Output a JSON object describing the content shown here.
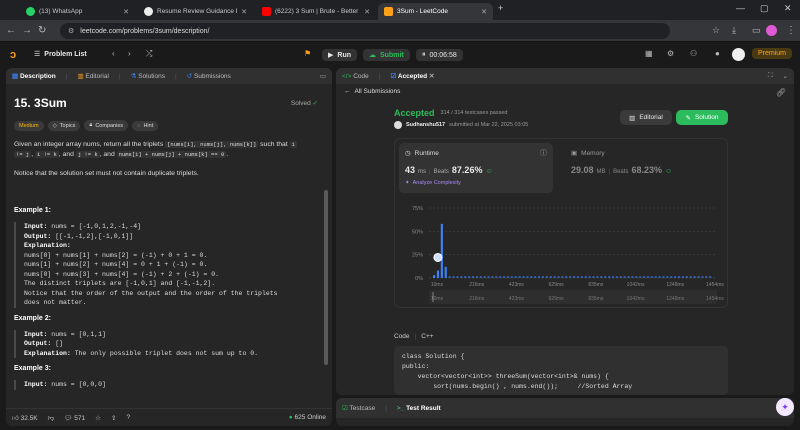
{
  "browser": {
    "tabs": [
      {
        "label": "(13) WhatsApp",
        "color": "#25d366"
      },
      {
        "label": "Resume Review Guidance Fit",
        "color": "#ececec"
      },
      {
        "label": "(6222) 3 Sum | Brute - Better - (",
        "color": "#ff0000"
      },
      {
        "label": "3Sum - LeetCode",
        "color": "#ffa116"
      }
    ],
    "url": "leetcode.com/problems/3sum/description/"
  },
  "header": {
    "problem_list": "Problem List",
    "run": "Run",
    "submit": "Submit",
    "timer": "00:06:58",
    "premium": "Premium"
  },
  "left": {
    "tabs": [
      "Description",
      "Editorial",
      "Solutions",
      "Submissions"
    ],
    "title": "15. 3Sum",
    "solved": "Solved",
    "tags": [
      "Medium",
      "Topics",
      "Companies",
      "Hint"
    ],
    "p1a": "Given an integer array nums, return all the triplets ",
    "p1code1": "[nums[i], nums[j], nums[k]]",
    "p1b": " such that ",
    "p1code2": "i",
    "p1c": "!= j",
    "p1d": ", ",
    "p1code3": "i != k",
    "p1e": ", and ",
    "p1code4": "j != k",
    "p1f": ", and ",
    "p1code5": "nums[i] + nums[j] + nums[k] == 0",
    "p1g": ".",
    "p2": "Notice that the solution set must not contain duplicate triplets.",
    "ex1_title": "Example 1:",
    "ex1_lines": [
      {
        "k": "Input:",
        "v": " nums = [-1,0,1,2,-1,-4]"
      },
      {
        "k": "Output:",
        "v": " [[-1,-1,2],[-1,0,1]]"
      },
      {
        "k": "Explanation:",
        "v": ""
      },
      {
        "k": "",
        "v": "nums[0] + nums[1] + nums[2] = (-1) + 0 + 1 = 0."
      },
      {
        "k": "",
        "v": "nums[1] + nums[2] + nums[4] = 0 + 1 + (-1) = 0."
      },
      {
        "k": "",
        "v": "nums[0] + nums[3] + nums[4] = (-1) + 2 + (-1) = 0."
      },
      {
        "k": "",
        "v": "The distinct triplets are [-1,0,1] and [-1,-1,2]."
      },
      {
        "k": "",
        "v": "Notice that the order of the output and the order of the triplets"
      },
      {
        "k": "",
        "v": "does not matter."
      }
    ],
    "ex2_title": "Example 2:",
    "ex2_lines": [
      {
        "k": "Input:",
        "v": " nums = [0,1,1]"
      },
      {
        "k": "Output:",
        "v": " []"
      },
      {
        "k": "Explanation:",
        "v": " The only possible triplet does not sum up to 0."
      }
    ],
    "ex3_title": "Example 3:",
    "ex3_lines": [
      {
        "k": "Input:",
        "v": " nums = [0,0,0]"
      }
    ],
    "likes": "32.5K",
    "comments": "571",
    "online": "625 Online"
  },
  "right": {
    "tabs": [
      "Code",
      "Accepted"
    ],
    "all_submissions": "All Submissions",
    "status": "Accepted",
    "testcases": "314 / 314 testcases passed",
    "user": "Sudhanshu517",
    "submitted": "submitted at Mar 22, 2025 03:05",
    "editorial": "Editorial",
    "solution": "Solution",
    "runtime_label": "Runtime",
    "runtime_value": "43",
    "runtime_unit": "ms",
    "beats_label": "Beats",
    "runtime_beats": "87.26%",
    "analyze": "Analyze Complexity",
    "memory_label": "Memory",
    "memory_value": "29.08",
    "memory_unit": "MB",
    "memory_beats": "68.23%",
    "code_label": "Code",
    "lang": "C++",
    "code": [
      "class Solution {",
      "public:",
      "    vector<vector<int>> threeSum(vector<int>& nums) {",
      "        sort(nums.begin() , nums.end());     //Sorted Array"
    ],
    "bottom_tabs": [
      "Testcase",
      "Test Result"
    ]
  },
  "chart_data": {
    "type": "bar",
    "y_ticks": [
      "75%",
      "50%",
      "25%",
      "0%"
    ],
    "x_ticks": [
      "10ms",
      "216ms",
      "423ms",
      "629ms",
      "835ms",
      "1042ms",
      "1248ms",
      "1454ms"
    ],
    "bars_pct": [
      3,
      8,
      58,
      12,
      2,
      2,
      2,
      2,
      2,
      2,
      2,
      2,
      2,
      2,
      2,
      2,
      2,
      2,
      2,
      2,
      2,
      2,
      2,
      2,
      2,
      2,
      2,
      2,
      2,
      2,
      2,
      2,
      2,
      2,
      2,
      2,
      2,
      2,
      2,
      2,
      2,
      2,
      2,
      2,
      2,
      2,
      2,
      2,
      2,
      2,
      2,
      2,
      2,
      2,
      2,
      2,
      2,
      2,
      2,
      2,
      2,
      2,
      2,
      2,
      2,
      2,
      2,
      2,
      2,
      2,
      2,
      2
    ],
    "ylim": [
      0,
      75
    ],
    "highlight_index": 1
  },
  "colors": {
    "accent": "#2cbb5d",
    "orange": "#ffa116",
    "blue": "#3b82f6"
  }
}
